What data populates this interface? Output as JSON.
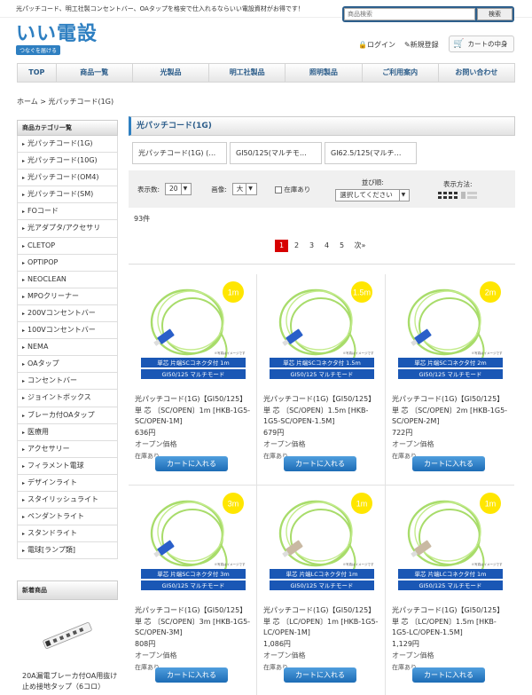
{
  "topline": "光パッチコード、明工社製コンセントバー、OAタップを格安で仕入れるならいい電設資材がお得です！",
  "search": {
    "placeholder": "商品検索",
    "button": "検索"
  },
  "logo": {
    "title": "いい電設",
    "slogan": "つなぐを届ける"
  },
  "header": {
    "login": "ログイン",
    "register": "新規登録",
    "cart": "カートの中身"
  },
  "nav": [
    "TOP",
    "商品一覧",
    "光製品",
    "明工社製品",
    "照明製品",
    "ご利用案内",
    "お問い合わせ"
  ],
  "breadcrumb": "ホーム > 光パッチコード(1G)",
  "sidebar": {
    "title": "商品カテゴリ一覧",
    "items": [
      "光パッチコード(1G)",
      "光パッチコード(10G)",
      "光パッチコード(OM4)",
      "光パッチコード(SM)",
      "FOコード",
      "光アダプタ/アクセサリ",
      "CLETOP",
      "OPTIPOP",
      "NEOCLEAN",
      "MPOクリーナー",
      "200Vコンセントバー",
      "100Vコンセントバー",
      "NEMA",
      "OAタップ",
      "コンセントバー",
      "ジョイントボックス",
      "ブレーカ付OAタップ",
      "医療用",
      "アクセサリー",
      "フィラメント電球",
      "デザインライト",
      "スタイリッシュライト",
      "ペンダントライト",
      "スタンドライト",
      "電球[ランプ類]"
    ],
    "new_title": "新着商品",
    "new_item": "20A漏電ブレーカ付OA用抜け止め接地タップ（6コロ）"
  },
  "main": {
    "title": "光パッチコード(1G)",
    "tabs": [
      "光パッチコード(1G) (…",
      "GI50/125(マルチモ…",
      "GI62.5/125(マルチ…"
    ],
    "options": {
      "per_page_label": "表示数:",
      "per_page": "20",
      "image_label": "画像:",
      "image": "大",
      "instock_label": "在庫あり",
      "sort_label": "並び順:",
      "sort": "選択してください",
      "view_label": "表示方法:"
    },
    "count": "93件",
    "pages": [
      "1",
      "2",
      "3",
      "4",
      "5",
      "次»"
    ]
  },
  "products": [
    {
      "name": "光パッチコード(1G)【GI50/125】 単 芯 〔SC/OPEN〕1m [HKB-1G5-SC/OPEN-1M]",
      "price": "636円",
      "note": "オープン価格",
      "stock": "在庫あり",
      "button": "カートに入れる",
      "badge": "1m",
      "label1": "単芯 片端SCコネクタ付 1m",
      "label2": "GI50/125 マルチモード",
      "conn_color": "#2a5fc9"
    },
    {
      "name": "光パッチコード(1G)【GI50/125】 単 芯 〔SC/OPEN〕1.5m [HKB-1G5-SC/OPEN-1.5M]",
      "price": "679円",
      "note": "オープン価格",
      "stock": "在庫あり",
      "button": "カートに入れる",
      "badge": "1.5m",
      "label1": "単芯 片端SCコネクタ付 1.5m",
      "label2": "GI50/125 マルチモード",
      "conn_color": "#2a5fc9"
    },
    {
      "name": "光パッチコード(1G)【GI50/125】 単 芯 〔SC/OPEN〕2m [HKB-1G5-SC/OPEN-2M]",
      "price": "722円",
      "note": "オープン価格",
      "stock": "在庫あり",
      "button": "カートに入れる",
      "badge": "2m",
      "label1": "単芯 片端SCコネクタ付 2m",
      "label2": "GI50/125 マルチモード",
      "conn_color": "#2a5fc9"
    },
    {
      "name": "光パッチコード(1G)【GI50/125】 単 芯 〔SC/OPEN〕3m [HKB-1G5-SC/OPEN-3M]",
      "price": "808円",
      "note": "オープン価格",
      "stock": "在庫あり",
      "button": "カートに入れる",
      "badge": "3m",
      "label1": "単芯 片端SCコネクタ付 3m",
      "label2": "GI50/125 マルチモード",
      "conn_color": "#2a5fc9"
    },
    {
      "name": "光パッチコード(1G)【GI50/125】 単 芯 〔LC/OPEN〕1m [HKB-1G5-LC/OPEN-1M]",
      "price": "1,086円",
      "note": "オープン価格",
      "stock": "在庫あり",
      "button": "カートに入れる",
      "badge": "1m",
      "label1": "単芯 片端LCコネクタ付 1m",
      "label2": "GI50/125 マルチモード",
      "conn_color": "#c9b9a3"
    },
    {
      "name": "光パッチコード(1G)【GI50/125】 単 芯 〔LC/OPEN〕1.5m [HKB-1G5-LC/OPEN-1.5M]",
      "price": "1,129円",
      "note": "オープン価格",
      "stock": "在庫あり",
      "button": "カートに入れる",
      "badge": "1m",
      "label1": "単芯 片端LCコネクタ付 1m",
      "label2": "GI50/125 マルチモード",
      "conn_color": "#c9b9a3"
    }
  ],
  "colors": {
    "brand": "#2e7fc1",
    "nav_text": "#2c5d8a",
    "pager_current": "#d70000",
    "cable": "#a8dc6a",
    "badge": "#ffe600"
  }
}
